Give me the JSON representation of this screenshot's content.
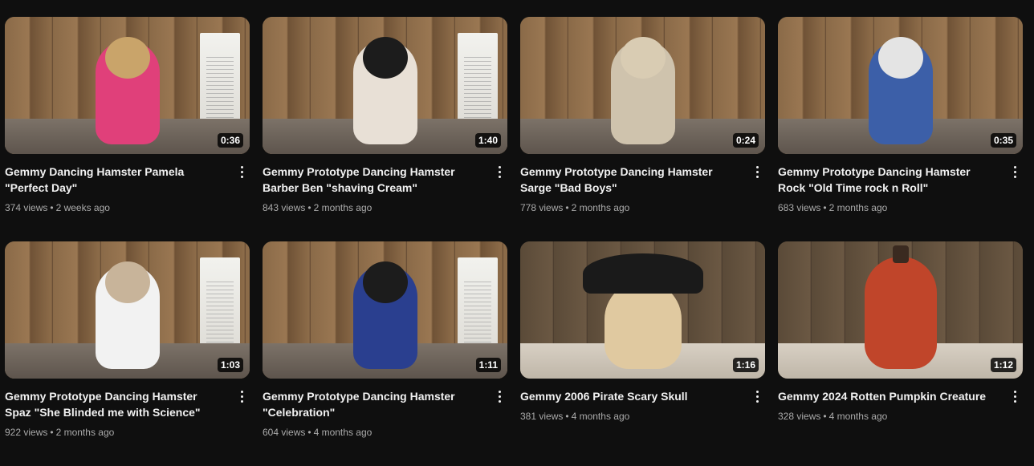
{
  "videos": [
    {
      "title": "Gemmy Dancing Hamster Pamela \"Perfect Day\"",
      "views": "374 views",
      "age": "2 weeks ago",
      "duration": "0:36",
      "body_color": "#c9a46a",
      "outfit_color": "#e0407a"
    },
    {
      "title": "Gemmy Prototype Dancing Hamster Barber Ben \"shaving Cream\"",
      "views": "843 views",
      "age": "2 months ago",
      "duration": "1:40",
      "body_color": "#1c1c1c",
      "outfit_color": "#e8e0d6"
    },
    {
      "title": "Gemmy Prototype Dancing Hamster Sarge \"Bad Boys\"",
      "views": "778 views",
      "age": "2 months ago",
      "duration": "0:24",
      "body_color": "#d9ccb3",
      "outfit_color": "#cfc3ad"
    },
    {
      "title": "Gemmy Prototype Dancing Hamster Rock \"Old Time rock n Roll\"",
      "views": "683 views",
      "age": "2 months ago",
      "duration": "0:35",
      "body_color": "#e4e4e4",
      "outfit_color": "#3c5fa8"
    },
    {
      "title": "Gemmy Prototype Dancing Hamster Spaz \"She Blinded me with Science\"",
      "views": "922 views",
      "age": "2 months ago",
      "duration": "1:03",
      "body_color": "#c8b49a",
      "outfit_color": "#f2f2f2"
    },
    {
      "title": "Gemmy Prototype Dancing Hamster \"Celebration\"",
      "views": "604 views",
      "age": "4 months ago",
      "duration": "1:11",
      "body_color": "#1c1c1c",
      "outfit_color": "#2a3f8f"
    },
    {
      "title": "Gemmy 2006 Pirate Scary Skull",
      "views": "381 views",
      "age": "4 months ago",
      "duration": "1:16",
      "body_color": "#e0c9a0",
      "outfit_color": "#1a1a1a"
    },
    {
      "title": "Gemmy 2024 Rotten Pumpkin Creature",
      "views": "328 views",
      "age": "4 months ago",
      "duration": "1:12",
      "body_color": "#c0452a",
      "outfit_color": "#3a2a20"
    }
  ]
}
